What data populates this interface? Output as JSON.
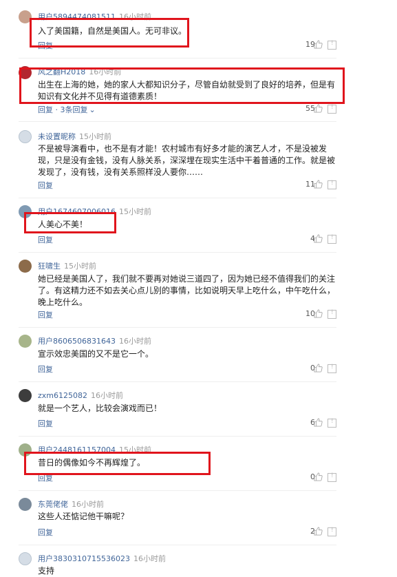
{
  "comments": [
    {
      "user": "用户5894474081511",
      "time": "16小时前",
      "text": "入了美国籍，自然是美国人。无可非议。",
      "reply": "回复",
      "likes": "19",
      "avatar_color": "#c8a08c"
    },
    {
      "user": "风之翻H2018",
      "time": "16小时前",
      "text": "出生在上海的她，她的家人大都知识分子，尽管自幼就受到了良好的培养，但是有知识有文化并不见得有道德素质！",
      "reply": "回复",
      "reply_more": " · 3条回复",
      "likes": "55",
      "avatar_color": "#b3262f"
    },
    {
      "user": "未设置昵称",
      "time": "15小时前",
      "text": "不是被导演看中，也不是有才能！农村城市有好多才能的演艺人才，不是没被发现，只是没有金钱，没有人脉关系，深深埋在现实生活中干着普通的工作。就是被发现了，没有钱，没有关系照样没人要你……",
      "reply": "回复",
      "likes": "11",
      "avatar_color": "#d5dde6"
    },
    {
      "user": "用户1674607006016",
      "time": "15小时前",
      "text": "人美心不美！",
      "reply": "回复",
      "likes": "4",
      "avatar_color": "#7f9ab3"
    },
    {
      "user": "狂啸生",
      "time": "15小时前",
      "text": "她已经是美国人了，我们就不要再对她说三道四了，因为她已经不值得我们的关注了。有这精力还不如去关心点儿别的事情，比如说明天早上吃什么，中午吃什么，晚上吃什么。",
      "reply": "回复",
      "likes": "10",
      "avatar_color": "#8c6b4a"
    },
    {
      "user": "用户8606506831643",
      "time": "16小时前",
      "text": "宣示效忠美国的又不是它一个。",
      "reply": "回复",
      "likes": "0",
      "avatar_color": "#a7b58a"
    },
    {
      "user": "zxm6125082",
      "time": "16小时前",
      "text": "就是一个艺人，比较会演戏而已！",
      "reply": "回复",
      "likes": "6",
      "avatar_color": "#3d3d3d"
    },
    {
      "user": "用户2448161157004",
      "time": "15小时前",
      "text": "昔日的偶像如今不再辉煌了。",
      "reply": "回复",
      "likes": "0",
      "avatar_color": "#9fb08a"
    },
    {
      "user": "东莞佬佬",
      "time": "16小时前",
      "text": "这些人还惦记他干嘛呢？",
      "reply": "回复",
      "likes": "2",
      "avatar_color": "#7a8a9a"
    },
    {
      "user": "用户3830310715536023",
      "time": "16小时前",
      "text": "支持",
      "reply": "",
      "likes": "",
      "avatar_color": "#d5dde6"
    }
  ],
  "colors": {
    "username": "#406599",
    "time": "#999999",
    "highlight": "#e0141c"
  }
}
